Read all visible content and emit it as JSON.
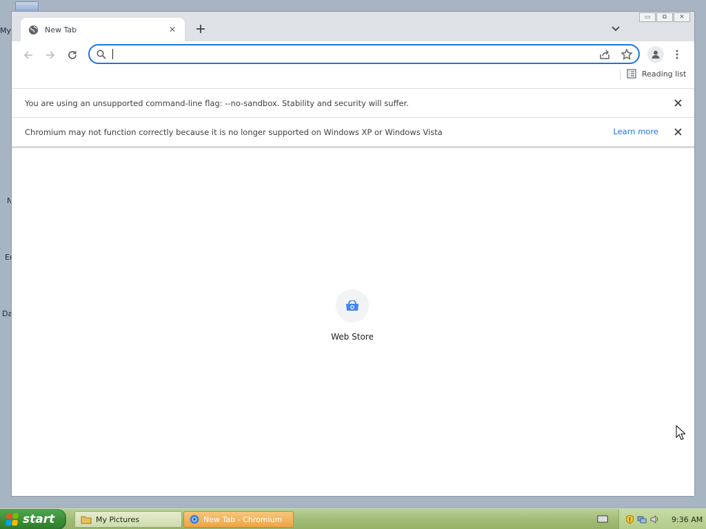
{
  "desktop": {
    "icon_labels": [
      "My",
      "N",
      "Er",
      "Da"
    ]
  },
  "window": {
    "controls": {
      "minimize_glyph": "▭",
      "maximize_glyph": "⧉",
      "close_glyph": "✕"
    }
  },
  "tab": {
    "title": "New Tab",
    "favicon": "globe-icon",
    "close_glyph": "✕"
  },
  "toolbar": {
    "omnibox_value": "",
    "icons": [
      "back-arrow-icon",
      "forward-arrow-icon",
      "reload-icon",
      "search-icon",
      "share-icon",
      "star-icon",
      "profile-icon",
      "kebab-menu-icon"
    ]
  },
  "bookmarks_bar": {
    "reading_list_label": "Reading list"
  },
  "infobars": [
    {
      "message": "You are using an unsupported command-line flag: --no-sandbox. Stability and security will suffer.",
      "link": ""
    },
    {
      "message": "Chromium may not function correctly because it is no longer supported on Windows XP or Windows Vista",
      "link": "Learn more"
    }
  ],
  "new_tab_page": {
    "shortcuts": [
      {
        "label": "Web Store",
        "icon": "web-store-icon"
      }
    ]
  },
  "taskbar": {
    "start_label": "start",
    "items": [
      {
        "label": "My Pictures",
        "icon": "folder-icon",
        "active": false
      },
      {
        "label": "New Tab - Chromium",
        "icon": "chromium-icon",
        "active": true
      }
    ],
    "clock": "9:36 AM"
  },
  "colors": {
    "accent": "#1a73e8",
    "taskbar": "#a2bd77",
    "start_button": "#3a8d36",
    "active_task": "#eca646"
  }
}
